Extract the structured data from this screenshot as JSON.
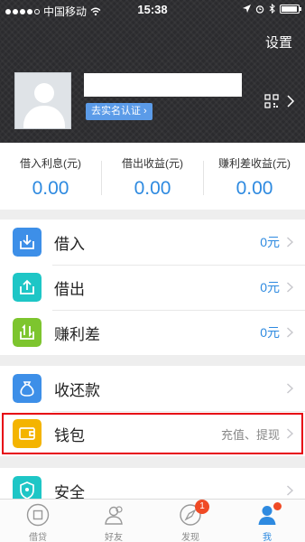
{
  "status_bar": {
    "carrier": "中国移动",
    "time": "15:38"
  },
  "header": {
    "settings_label": "设置",
    "verify_label": "去实名认证 ›"
  },
  "summary": [
    {
      "label": "借入利息(元)",
      "value": "0.00"
    },
    {
      "label": "借出收益(元)",
      "value": "0.00"
    },
    {
      "label": "赚利差收益(元)",
      "value": "0.00"
    }
  ],
  "menu": {
    "borrow_in": {
      "title": "借入",
      "value": "0元"
    },
    "lend_out": {
      "title": "借出",
      "value": "0元"
    },
    "spread": {
      "title": "赚利差",
      "value": "0元"
    },
    "repayment": {
      "title": "收还款"
    },
    "wallet": {
      "title": "钱包",
      "value": "充值、提现"
    },
    "security": {
      "title": "安全"
    }
  },
  "tabbar": {
    "items": [
      {
        "label": "借贷",
        "icon": "loan-icon"
      },
      {
        "label": "好友",
        "icon": "friends-icon"
      },
      {
        "label": "发现",
        "icon": "compass-icon",
        "badge": "1"
      },
      {
        "label": "我",
        "icon": "person-icon"
      }
    ]
  },
  "colors": {
    "accent": "#2e8ae0",
    "highlight_border": "#e60012",
    "badge": "#f04a25"
  }
}
